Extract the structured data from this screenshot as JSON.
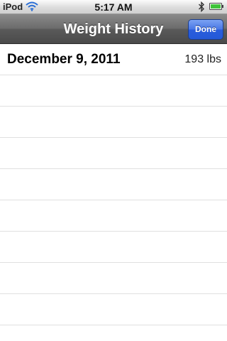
{
  "status_bar": {
    "carrier": "iPod",
    "time": "5:17 AM",
    "wifi_icon": "wifi-icon",
    "bluetooth_icon": "bluetooth-icon",
    "battery_icon": "battery-icon",
    "battery_level": 1.0,
    "battery_color": "#3fc43a"
  },
  "nav_bar": {
    "title": "Weight History",
    "done_label": "Done",
    "done_color": "#2f62dd"
  },
  "entries": [
    {
      "date": "December 9, 2011",
      "weight": "193 lbs"
    }
  ]
}
